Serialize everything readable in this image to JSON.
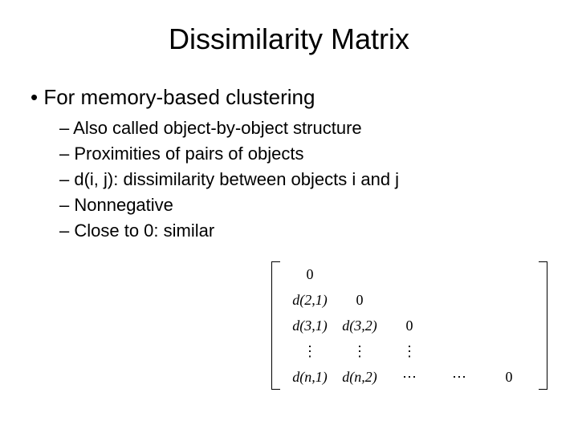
{
  "slide": {
    "title": "Dissimilarity Matrix",
    "bullet1": "For memory-based clustering",
    "sub1": "Also called object-by-object structure",
    "sub2": "Proximities of pairs of objects",
    "sub3": "d(i, j): dissimilarity between objects i and j",
    "sub4": "Nonnegative",
    "sub5": "Close to 0: similar"
  },
  "matrix": {
    "r0c0": "0",
    "r1c0": "d(2,1)",
    "r1c1": "0",
    "r2c0": "d(3,1)",
    "r2c1": "d(3,2)",
    "r2c2": "0",
    "r3c0": "⋮",
    "r3c1": "⋮",
    "r3c2": "⋮",
    "r4c0": "d(n,1)",
    "r4c1": "d(n,2)",
    "r4c2": "⋯",
    "r4c3": "⋯",
    "r4c4": "0"
  }
}
